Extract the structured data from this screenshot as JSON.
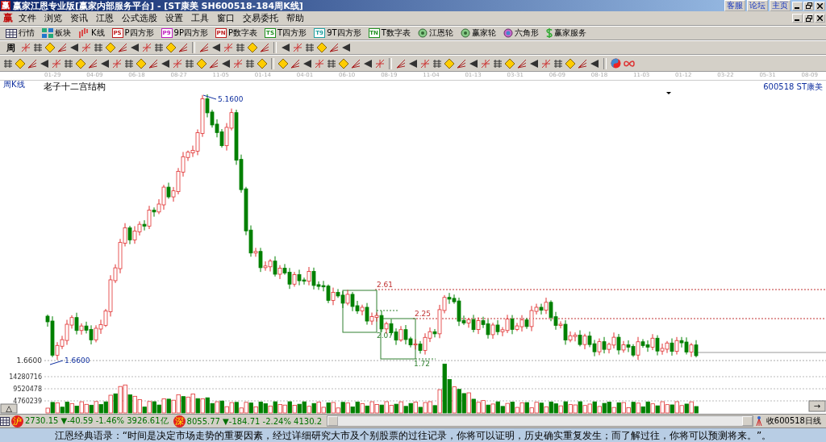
{
  "title_bar": {
    "logo": "赢",
    "title": "赢家江恩专业版[赢家内部服务平台] - [ST康美   SH600518-184周K线]",
    "links": [
      {
        "label": "客服"
      },
      {
        "label": "论坛"
      },
      {
        "label": "主页"
      }
    ]
  },
  "menu_bar": {
    "logo": "赢",
    "items": [
      "文件",
      "浏览",
      "资讯",
      "江恩",
      "公式选股",
      "设置",
      "工具",
      "窗口",
      "交易委托",
      "帮助"
    ]
  },
  "main_toolbar": [
    {
      "label": "行情",
      "kind": "grid"
    },
    {
      "label": "板块",
      "kind": "blocks"
    },
    {
      "label": "K线",
      "kind": "candles"
    },
    {
      "label": "P四方形",
      "kind": "badge",
      "badge": "PS",
      "color": "#c02020"
    },
    {
      "label": "9P四方形",
      "kind": "badge",
      "badge": "P9",
      "color": "#c020c0"
    },
    {
      "label": "P数字表",
      "kind": "badge",
      "badge": "PN",
      "color": "#c02020"
    },
    {
      "label": "T四方形",
      "kind": "badge",
      "badge": "TS",
      "color": "#209020"
    },
    {
      "label": "9T四方形",
      "kind": "badge",
      "badge": "T9",
      "color": "#20a0a0"
    },
    {
      "label": "T数字表",
      "kind": "badge",
      "badge": "TN",
      "color": "#209020"
    },
    {
      "label": "江恩轮",
      "kind": "wheel"
    },
    {
      "label": "赢家轮",
      "kind": "wheel"
    },
    {
      "label": "六角形",
      "kind": "hexagon"
    },
    {
      "label": "赢家服务",
      "kind": "dollar"
    }
  ],
  "period_selector": "周",
  "date_axis": [
    "01-29",
    "04-09",
    "06-18",
    "08-27",
    "11-05",
    "01-14",
    "04-01",
    "06-10",
    "08-19",
    "11-04",
    "01-13",
    "03-31",
    "06-09",
    "08-18",
    "11-03",
    "01-12",
    "03-22",
    "05-31",
    "08-09"
  ],
  "chart": {
    "period_label": "周K线",
    "title": "老子十二宫结构",
    "symbol": "600518 ST康美",
    "high_label": "5.1600",
    "low_label": "1.6600",
    "axis_label": "1.6600",
    "levels": [
      {
        "label": "2.61",
        "kind": "resistance"
      },
      {
        "label": "2.25",
        "kind": "resistance"
      },
      {
        "label": "2.07",
        "kind": "box"
      },
      {
        "label": "1.72",
        "kind": "box"
      }
    ],
    "volume_ticks": [
      "14280716",
      "9520478",
      "4760239"
    ],
    "left_button": "△",
    "right_button": "→"
  },
  "status_bar": {
    "markets": [
      {
        "badge": "沪",
        "text": "2730.15 ▼-40.59 -1.46% 3926.61亿"
      },
      {
        "badge": "深",
        "text": "8055.77 ▼-184.71 -2.24% 4130.2"
      }
    ],
    "status": "收600518日线"
  },
  "quote": "江恩经典语录：“时间是决定市场走势的重要因素，经过详细研究大市及个别股票的过往记录，你将可以证明，历史确实重复发生；而了解过往，你将可以预测将来。”。"
}
